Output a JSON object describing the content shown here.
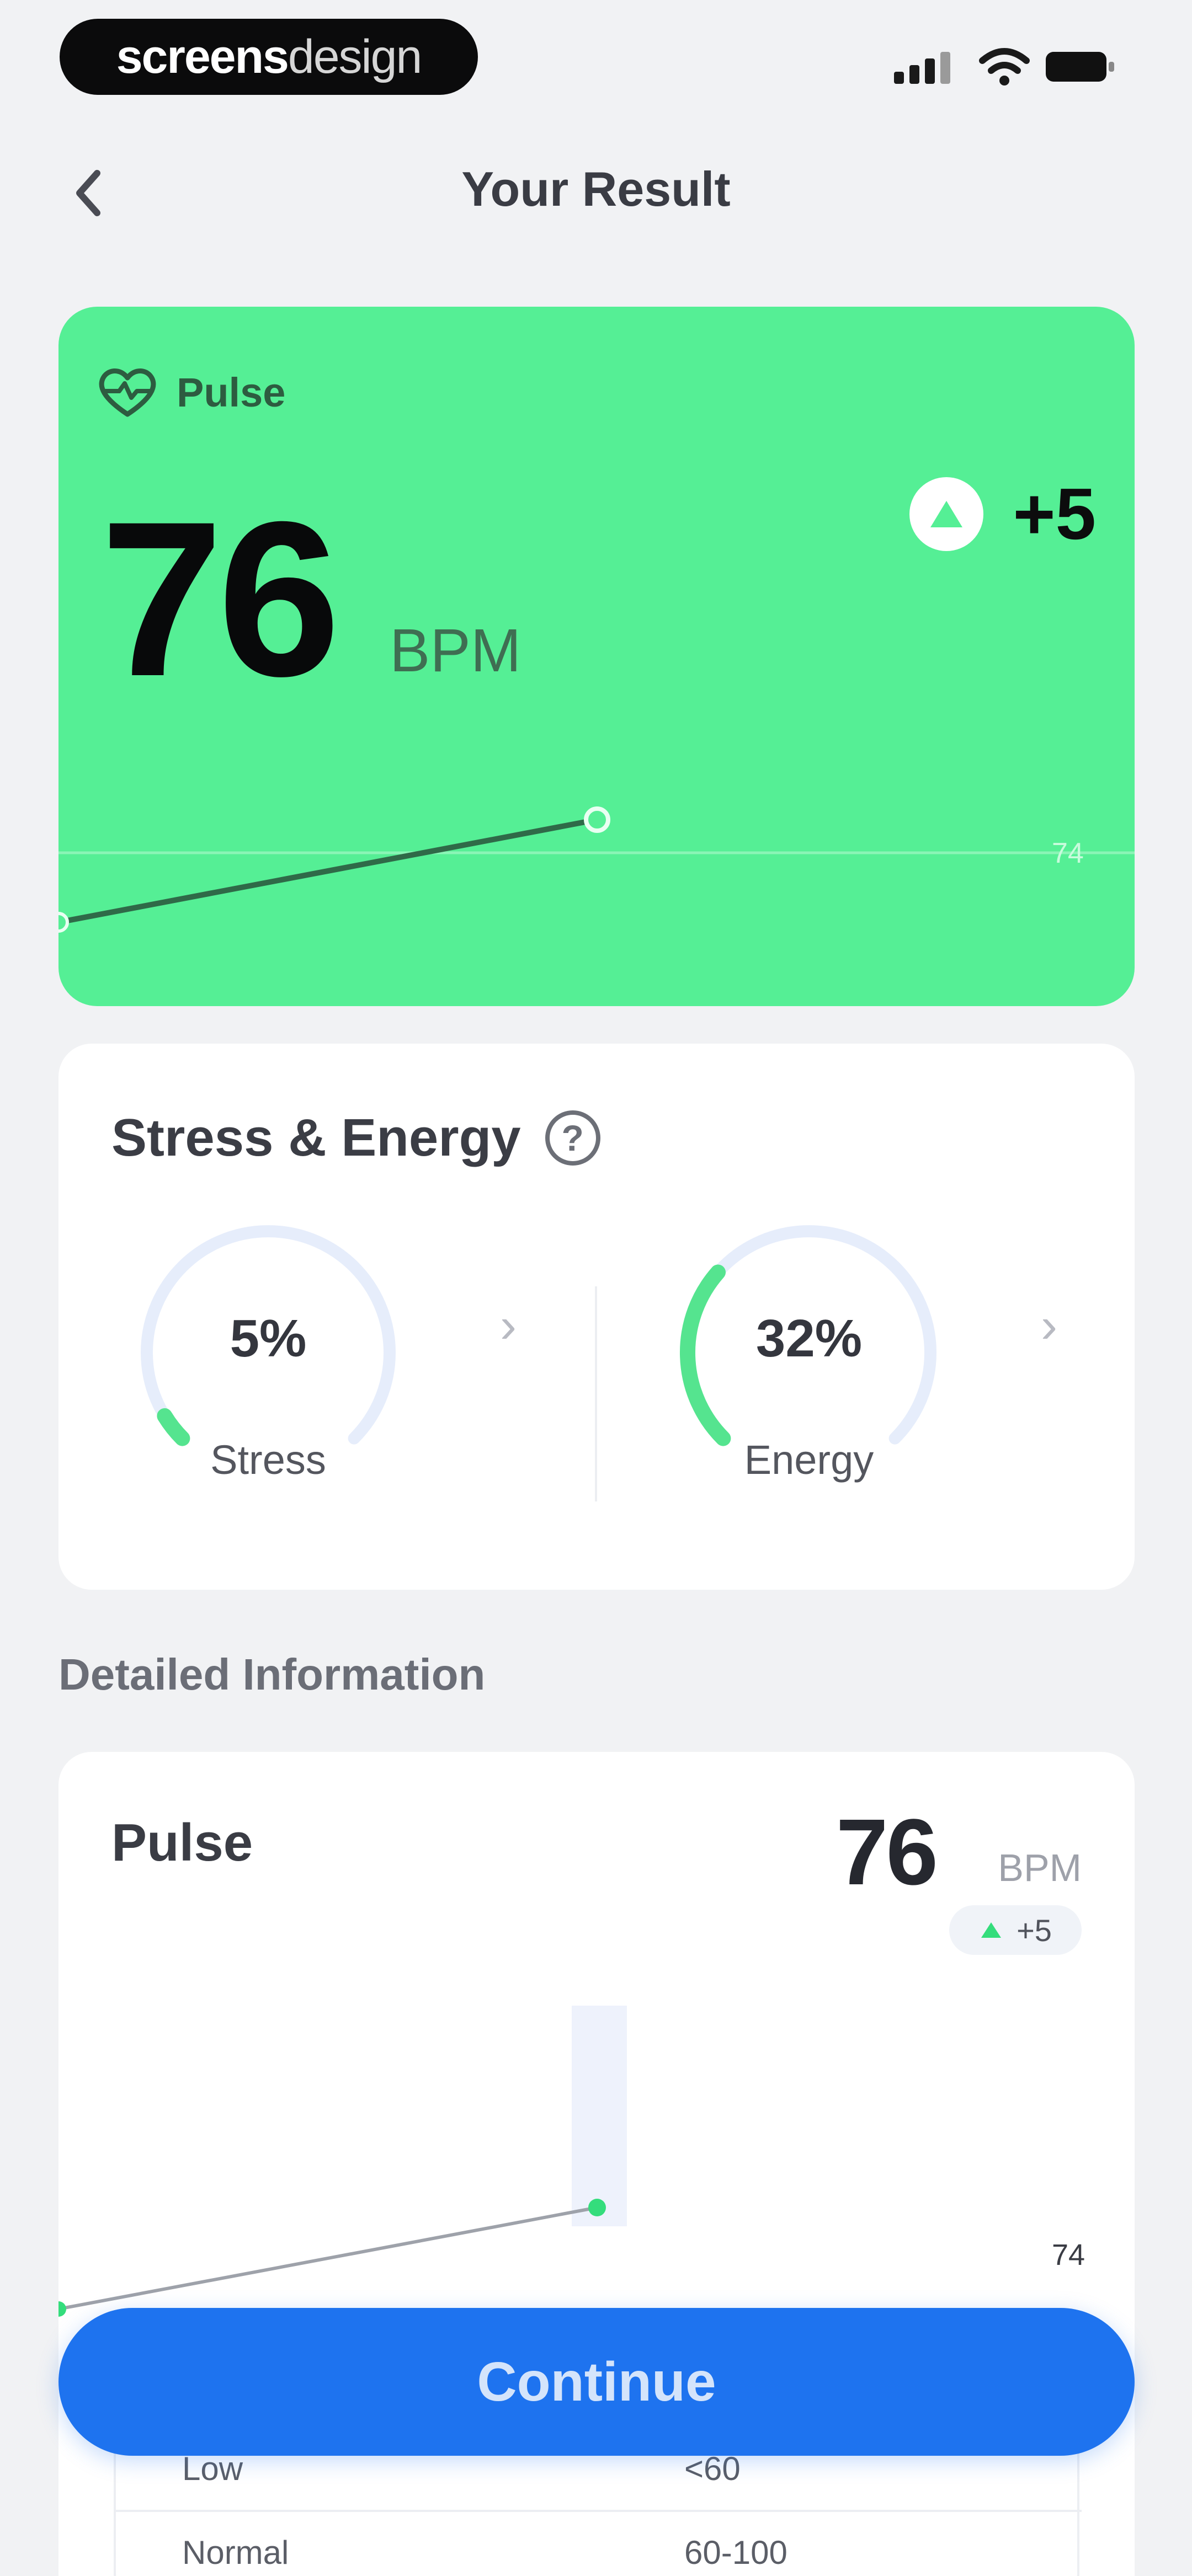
{
  "status_bar": {
    "brand_main": "screens",
    "brand_thin": "design"
  },
  "header": {
    "title": "Your Result"
  },
  "pulse_card": {
    "label": "Pulse",
    "value": "76",
    "unit": "BPM",
    "delta": "+5",
    "reference_label": "74",
    "colors": {
      "background": "#55ef95",
      "line": "#2f6a48"
    }
  },
  "stress_energy": {
    "title": "Stress & Energy",
    "help_icon_text": "?",
    "stress": {
      "value": "5%",
      "label": "Stress",
      "level": 0.05
    },
    "energy": {
      "value": "32%",
      "label": "Energy",
      "level": 0.32
    },
    "chevron": "›",
    "colors": {
      "track": "#e6edfb",
      "fill": "#55e48f"
    }
  },
  "detailed_information": {
    "heading": "Detailed Information",
    "title": "Pulse",
    "value": "76",
    "unit": "BPM",
    "delta": "+5",
    "reference_label": "74",
    "range_rows": [
      {
        "label": "Low",
        "range": "<60"
      },
      {
        "label": "Normal",
        "range": "60-100"
      }
    ]
  },
  "continue_button": {
    "label": "Continue",
    "color": "#1e73ef"
  }
}
